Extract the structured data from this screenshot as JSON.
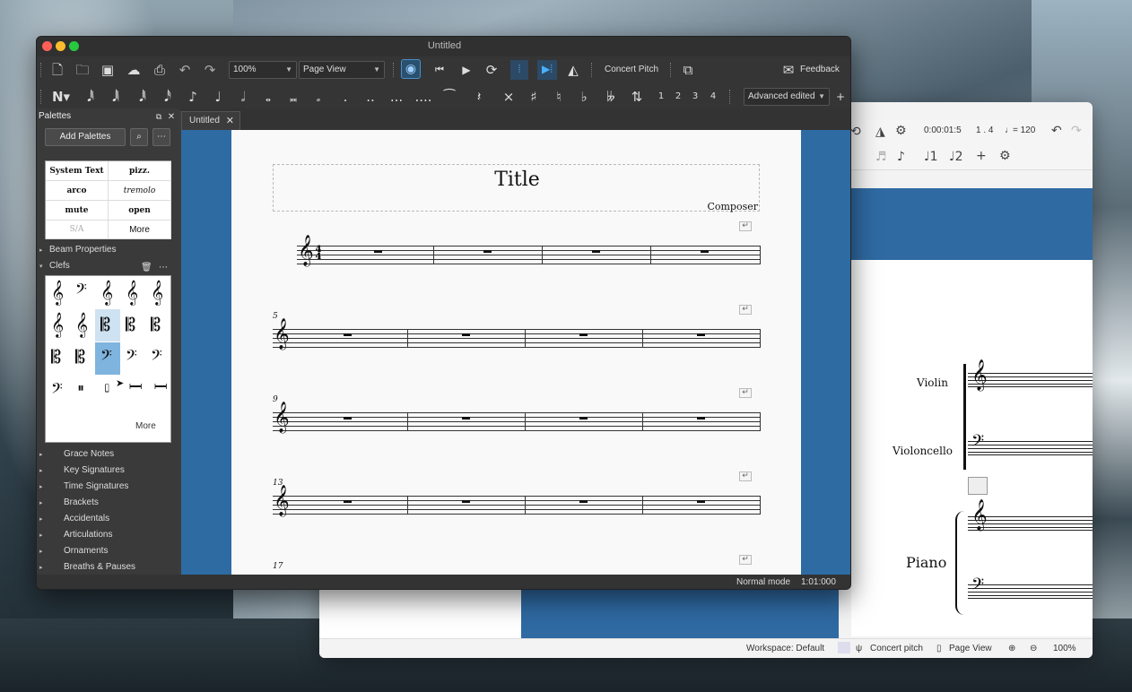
{
  "main_window": {
    "title": "Untitled",
    "toolbar": {
      "zoom": "100%",
      "view_mode": "Page View",
      "concert_pitch": "Concert Pitch",
      "feedback": "Feedback"
    },
    "note_toolbar": {
      "voices": [
        "1",
        "2",
        "3",
        "4"
      ],
      "workspace": "Advanced edited"
    },
    "palettes": {
      "title": "Palettes",
      "add_button": "Add Palettes",
      "text_cells": [
        "System Text",
        "pizz.",
        "arco",
        "tremolo",
        "mute",
        "open",
        "S/A",
        "More"
      ],
      "expanded_sections": [
        "Beam Properties",
        "Clefs"
      ],
      "clefs_more": "More",
      "sections": [
        "Grace Notes",
        "Key Signatures",
        "Time Signatures",
        "Brackets",
        "Accidentals",
        "Articulations",
        "Ornaments",
        "Breaths & Pauses"
      ]
    },
    "tab": "Untitled",
    "score": {
      "title": "Title",
      "composer": "Composer",
      "measure_numbers": [
        "5",
        "9",
        "13",
        "17"
      ]
    },
    "status": {
      "mode": "Normal mode",
      "position": "1:01:000"
    }
  },
  "back_window": {
    "toolbar": {
      "time": "0:00:01:5",
      "measure_beat": "1 . 4",
      "tempo": "= 120"
    },
    "instruments": [
      "Violin",
      "Violoncello",
      "Piano"
    ],
    "status": {
      "workspace": "Workspace: Default",
      "concert_pitch": "Concert pitch",
      "page_view": "Page View",
      "zoom": "100%"
    }
  },
  "colors": {
    "accent_blue": "#2e6ba3",
    "selection": "#7fb4de"
  }
}
